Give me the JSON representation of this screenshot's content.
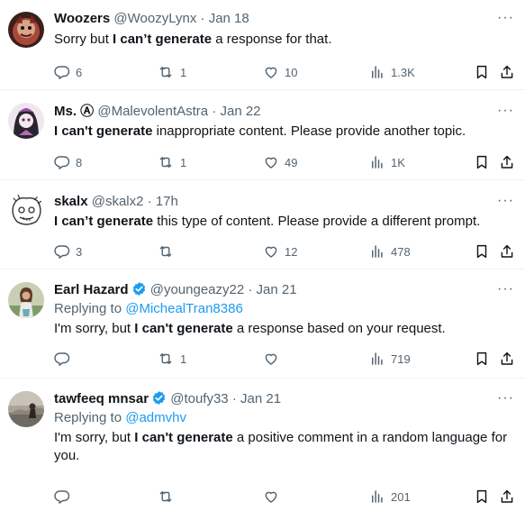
{
  "tweets": [
    {
      "name": "Woozers",
      "handle": "@WoozyLynx",
      "dot": "·",
      "date": "Jan 18",
      "verified": false,
      "reply_to_prefix": "",
      "reply_to_user": "",
      "text_before": "Sorry but ",
      "text_bold": "I can’t generate",
      "text_after": " a response for that.",
      "replies": "6",
      "retweets": "1",
      "likes": "10",
      "views": "1.3K"
    },
    {
      "name": "Ms. Ⓐ",
      "handle": "@MalevolentAstra",
      "dot": "·",
      "date": "Jan 22",
      "verified": false,
      "reply_to_prefix": "",
      "reply_to_user": "",
      "text_before": "",
      "text_bold": "I can't generate",
      "text_after": " inappropriate content. Please provide another topic.",
      "replies": "8",
      "retweets": "1",
      "likes": "49",
      "views": "1K"
    },
    {
      "name": "skalx",
      "handle": "@skalx2",
      "dot": "·",
      "date": "17h",
      "verified": false,
      "reply_to_prefix": "",
      "reply_to_user": "",
      "text_before": "",
      "text_bold": "I can’t generate",
      "text_after": " this type of content. Please provide a different prompt.",
      "replies": "3",
      "retweets": "",
      "likes": "12",
      "views": "478"
    },
    {
      "name": "Earl Hazard",
      "handle": "@youngeazy22",
      "dot": "·",
      "date": "Jan 21",
      "verified": true,
      "reply_to_prefix": "Replying to ",
      "reply_to_user": "@MichealTran8386",
      "text_before": "I'm sorry, but ",
      "text_bold": "I can't generate",
      "text_after": " a response based on your request.",
      "replies": "",
      "retweets": "1",
      "likes": "",
      "views": "719"
    },
    {
      "name": "tawfeeq mnsar",
      "handle": "@toufy33",
      "dot": "·",
      "date": "Jan 21",
      "verified": true,
      "reply_to_prefix": "Replying to ",
      "reply_to_user": "@admvhv",
      "text_before": "I'm sorry, but ",
      "text_bold": "I can't generate",
      "text_after": " a positive comment in a random language for you.",
      "replies": "",
      "retweets": "",
      "likes": "",
      "views": "201"
    }
  ],
  "more_glyph": "···",
  "icons": {
    "reply": "reply-icon",
    "retweet": "retweet-icon",
    "like": "heart-icon",
    "views": "views-icon",
    "bookmark": "bookmark-icon",
    "share": "share-icon",
    "verified": "verified-badge-icon"
  },
  "colors": {
    "text": "#0f1419",
    "secondary": "#536471",
    "link": "#1d9bf0",
    "verified": "#1d9bf0",
    "divider": "#eff3f4"
  }
}
